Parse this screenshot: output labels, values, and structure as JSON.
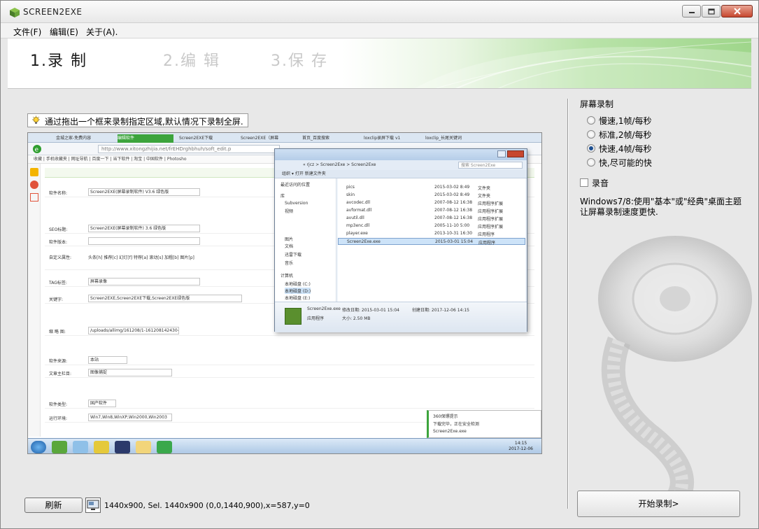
{
  "window": {
    "title": "SCREEN2EXE"
  },
  "menu": {
    "items": [
      "文件(F)",
      "编辑(E)",
      "关于(A)."
    ]
  },
  "steps": [
    {
      "label": "1.录  制",
      "active": true
    },
    {
      "label": "2.编  辑",
      "active": false
    },
    {
      "label": "3.保  存",
      "active": false
    }
  ],
  "left": {
    "hint": "通过拖出一个框来录制指定区域,默认情况下录制全屏.",
    "refresh_label": "刷新",
    "status": "1440x900, Sel. 1440x900 (0,0,1440,900),x=587,y=0"
  },
  "preview": {
    "tabs": [
      "金城之家-免费内容",
      "编辑软件",
      "Screen2EXE下载",
      "Screen2EXE（屏幕",
      "首页_百度搜索",
      "loxclip录屏下载 v1",
      "loxclip_长尾关键词"
    ],
    "address": "http://www.xitongzhijia.net/frEHDrghbhuh/soft_edit.p",
    "bookmarks": "收藏 | 手机收藏夹 | 网址导航 | 百度一下 | 当下软件 | 淘宝 | 中国软件 | Photosho",
    "form_rows": [
      {
        "label": "软件名称:",
        "value": "Screen2EXE(屏幕录制软件) V3.6 绿色版"
      },
      {
        "label": "SEO标题:",
        "value": "Screen2EXE(屏幕录制软件) 3.6 绿色版"
      },
      {
        "label": "软件版本:",
        "value": ""
      },
      {
        "label": "自定义属性:",
        "value": "头条[h] 推荐[c] 幻灯[f] 特荐[a] 滚动[s] 加粗[b] 图片[p]"
      },
      {
        "label": "TAG标签:",
        "value": "屏幕录像"
      },
      {
        "label": "关键字:",
        "value": "Screen2EXE,Screen2EXE下载,Screen2EXE绿色版"
      },
      {
        "label": "缩 略 图:",
        "value": "/uploads/allimg/161208/1-161208142430-L"
      },
      {
        "label": "软件来源:",
        "value": "本站"
      },
      {
        "label": "文章主栏目:",
        "value": "图像捕捉"
      },
      {
        "label": "软件类型:",
        "value": "国产软件"
      },
      {
        "label": "运行环境:",
        "value": "Win7,Win8,WinXP,Win2000,Win2003"
      }
    ],
    "explorer": {
      "path": "« rjcz > Screen2Exe > Screen2Exe",
      "search": "搜索 Screen2Exe",
      "toolbar": "组织 ▾   打开   新建文件夹",
      "tree": [
        "最近访问的位置",
        "库",
        "Subversion",
        "视频",
        "图片",
        "文档",
        "迅雷下载",
        "音乐",
        "计算机",
        "本地磁盘 (C:)",
        "本地磁盘 (D:)",
        "本地磁盘 (E:)"
      ],
      "files": [
        {
          "name": "pics",
          "date": "2015-03-02 8:49",
          "type": "文件夹"
        },
        {
          "name": "skin",
          "date": "2015-03-02 8:49",
          "type": "文件夹"
        },
        {
          "name": "avcodec.dll",
          "date": "2007-08-12 16:38",
          "type": "应用程序扩展"
        },
        {
          "name": "avformat.dll",
          "date": "2007-08-12 16:38",
          "type": "应用程序扩展"
        },
        {
          "name": "avutil.dll",
          "date": "2007-08-12 16:38",
          "type": "应用程序扩展"
        },
        {
          "name": "mp3enc.dll",
          "date": "2005-11-10 5:00",
          "type": "应用程序扩展"
        },
        {
          "name": "player.exe",
          "date": "2013-10-31 16:30",
          "type": "应用程序"
        },
        {
          "name": "Screen2Exe.exe",
          "date": "2015-03-01 15:04",
          "type": "应用程序"
        }
      ],
      "status_name": "Screen2Exe.exe",
      "status_modified": "修改日期: 2015-03-01 15:04",
      "status_created": "创建日期: 2017-12-06 14:15",
      "status_type": "应用程序",
      "status_size": "大小: 2.50 MB"
    },
    "popup_title": "360保镖提示",
    "popup_text": "下载完毕，正在安全检测",
    "popup_file": "Screen2Exe.exe",
    "clock_time": "14:15",
    "clock_date": "2017-12-06"
  },
  "right": {
    "heading": "屏幕录制",
    "options": [
      {
        "label": "慢速,1帧/每秒",
        "checked": false
      },
      {
        "label": "标准,2帧/每秒",
        "checked": false
      },
      {
        "label": "快速,4帧/每秒",
        "checked": true
      },
      {
        "label": "快,尽可能的快",
        "checked": false
      }
    ],
    "audio_label": "录音",
    "note": "Windows7/8:使用\"基本\"或\"经典\"桌面主题让屏幕录制速度更快.",
    "start_label": "开始录制>"
  },
  "colors": {
    "banner_green": "#9fd68b",
    "radio_dot": "#1d4f91",
    "close_red": "#c7472f"
  }
}
